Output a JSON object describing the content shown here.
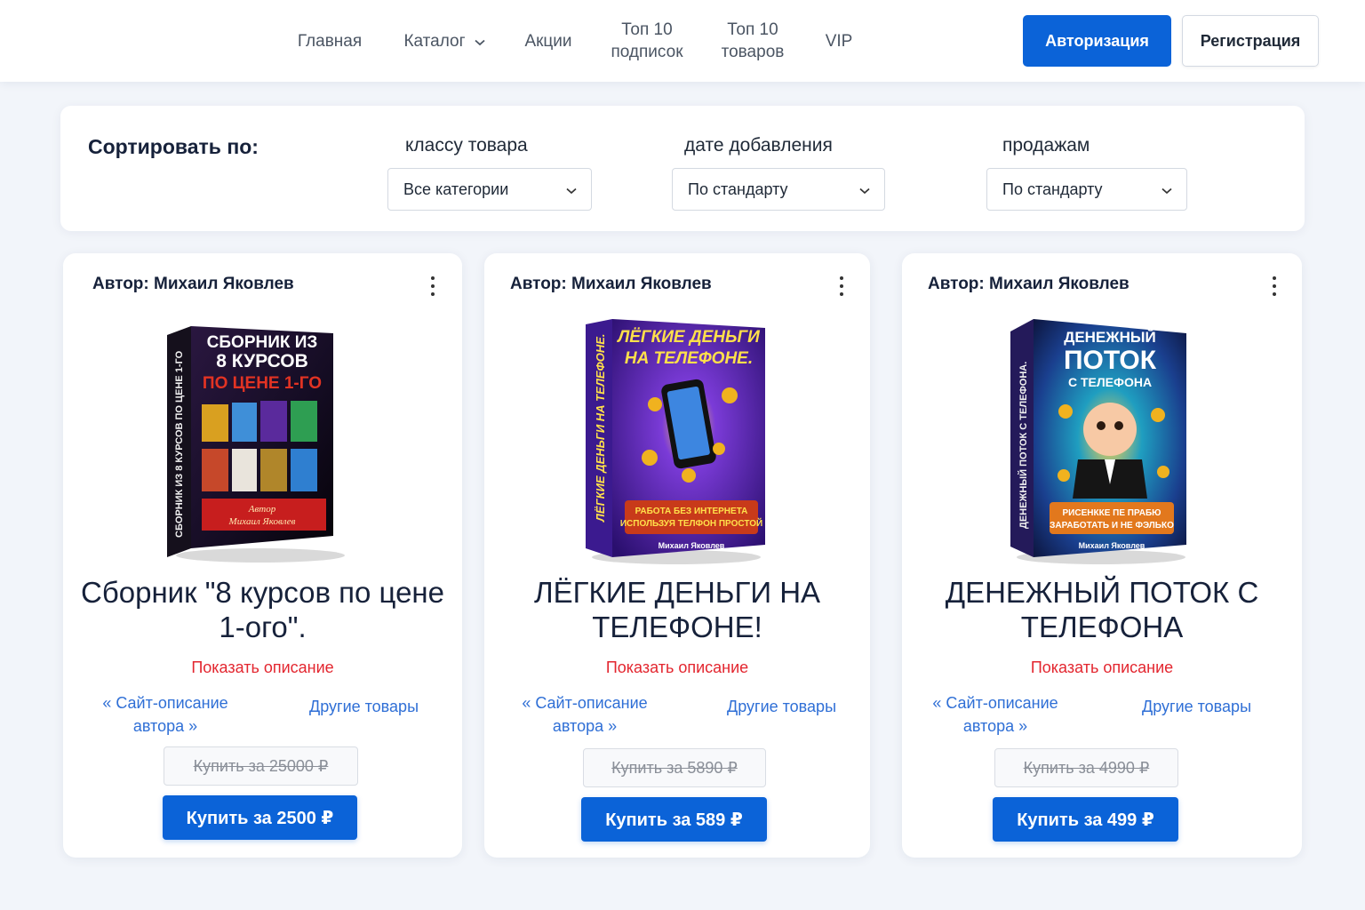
{
  "nav": {
    "home": "Главная",
    "catalog": "Каталог",
    "promos": "Акции",
    "top_subs_1": "Топ 10",
    "top_subs_2": "подписок",
    "top_goods_1": "Топ 10",
    "top_goods_2": "товаров",
    "vip": "VIP",
    "login": "Авторизация",
    "register": "Регистрация"
  },
  "sort": {
    "title": "Сортировать по:",
    "class_label": "классу товара",
    "class_value": "Все категории",
    "date_label": "дате добавления",
    "date_value": "По стандарту",
    "sales_label": "продажам",
    "sales_value": "По стандарту"
  },
  "products": [
    {
      "author": "Автор: Михаил Яковлев",
      "title": "Сборник \"8 курсов по цене 1-ого\".",
      "show_description": "Показать описание",
      "site_link_1": "« Сайт-описание",
      "site_link_2": "автора »",
      "other_goods": "Другие товары",
      "old_price": "Купить за 25000 ₽",
      "buy": "Купить за 2500 ₽",
      "cover": {
        "top": "СБОРНИК ИЗ",
        "mid": "8 КУРСОВ",
        "accent": "ПО ЦЕНЕ 1-ГО",
        "spine": "СБОРНИК ИЗ 8 КУРСОВ ПО ЦЕНЕ 1-ГО",
        "banner_1": "Автор",
        "banner_2": "Михаил Яковлев"
      }
    },
    {
      "author": "Автор: Михаил Яковлев",
      "title": "ЛЁГКИЕ ДЕНЬГИ НА ТЕЛЕФОНЕ!",
      "show_description": "Показать описание",
      "site_link_1": "« Сайт-описание",
      "site_link_2": "автора »",
      "other_goods": "Другие товары",
      "old_price": "Купить за 5890 ₽",
      "buy": "Купить за 589 ₽",
      "cover": {
        "top": "ЛЁГКИЕ ДЕНЬГИ",
        "mid": "НА ТЕЛЕФОНЕ.",
        "spine": "ЛЁГКИЕ ДЕНЬГИ НА ТЕЛЕФОНЕ.",
        "banner_1": "РАБОТА БЕЗ ИНТЕРНЕТА",
        "banner_2": "ИСПОЛЬЗУЯ ТЕЛФОН ПРОСТОЙ",
        "footer": "Михаил Яковлев"
      }
    },
    {
      "author": "Автор: Михаил Яковлев",
      "title": "ДЕНЕЖНЫЙ ПОТОК С ТЕЛЕФОНА",
      "show_description": "Показать описание",
      "site_link_1": "« Сайт-описание",
      "site_link_2": "автора »",
      "other_goods": "Другие товары",
      "old_price": "Купить за 4990 ₽",
      "buy": "Купить за 499 ₽",
      "cover": {
        "top": "ДЕНЕЖНЫЙ",
        "mid": "ПОТОК",
        "accent": "С ТЕЛЕФОНА",
        "spine": "ДЕНЕЖНЫЙ ПОТОК С ТЕЛЕФОНА.",
        "banner_1": "РИСЕНККЕ ПЕ ПРАБЮ",
        "banner_2": "ЗАРАБОТАТЬ И НЕ ФЭЛЬКО",
        "footer": "Михаил Яковлев"
      }
    }
  ],
  "colors": {
    "primary": "#0b63d8",
    "link": "#2f6fd6",
    "accent_red": "#e3262f",
    "background": "#f2f5fa"
  },
  "icons": [
    "chevron-down-icon",
    "more-vertical-icon"
  ]
}
